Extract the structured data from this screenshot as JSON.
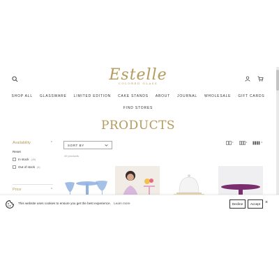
{
  "logo": {
    "main": "Estelle",
    "sub": "COLORED GLASS"
  },
  "nav": {
    "row1": [
      "SHOP ALL",
      "GLASSWARE",
      "LIMITED EDITION",
      "CAKE STANDS",
      "ABOUT",
      "JOURNAL",
      "WHOLESALE",
      "GIFT CARDS"
    ],
    "row2": [
      "FIND STORES"
    ]
  },
  "title": "PRODUCTS",
  "filters": {
    "availability": "Availability",
    "reset": "Reset",
    "options": [
      {
        "label": "In stock",
        "count": "(49)"
      },
      {
        "label": "Out of stock",
        "count": "(6)"
      }
    ],
    "price": "Price"
  },
  "sort": {
    "label": "SORT BY"
  },
  "product_count": "49 products",
  "views": [
    "1",
    "2",
    "3"
  ],
  "cookie": {
    "text": "This website uses cookies to ensure you get the best experience.",
    "learn_more": "Learn more",
    "decline": "Decline",
    "accept": "Accept"
  },
  "colors": {
    "gold": "#b49a5c",
    "purple": "#7a2e6e",
    "blue": "#8fb2e0"
  }
}
